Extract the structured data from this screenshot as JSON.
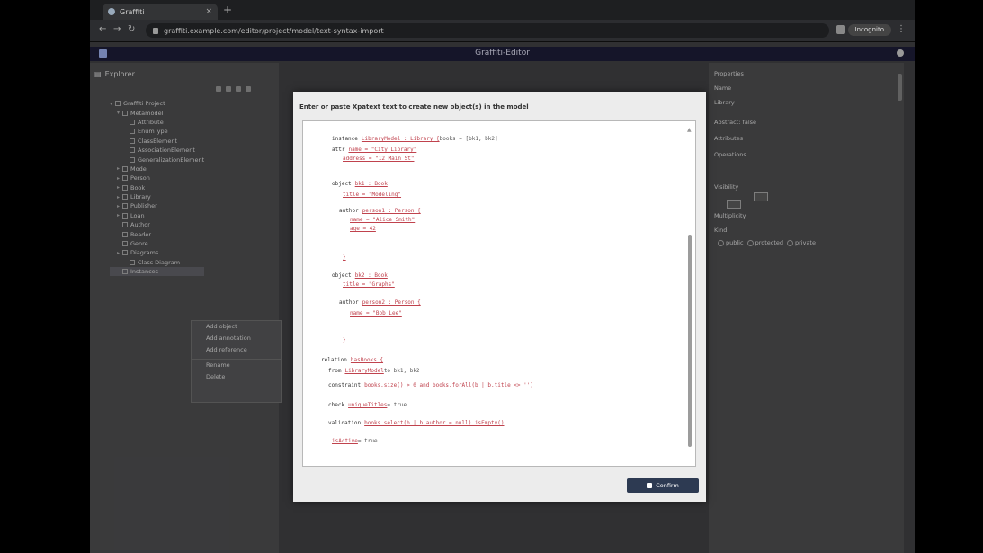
{
  "browser": {
    "tab_title": "Graffiti",
    "tab_close": "×",
    "new_tab": "+",
    "url": "graffiti.example.com/editor/project/model/text-syntax-import",
    "profile": "Incognito"
  },
  "app": {
    "title": "Graffiti-Editor"
  },
  "left_panel": {
    "title": "Explorer",
    "tree": [
      {
        "label": "Graffiti Project",
        "indent": 0,
        "twisty": "▾"
      },
      {
        "label": "Metamodel",
        "indent": 1,
        "twisty": "▾"
      },
      {
        "label": "Attribute",
        "indent": 2,
        "twisty": ""
      },
      {
        "label": "EnumType",
        "indent": 2,
        "twisty": ""
      },
      {
        "label": "ClassElement",
        "indent": 2,
        "twisty": ""
      },
      {
        "label": "AssociationElement",
        "indent": 2,
        "twisty": ""
      },
      {
        "label": "GeneralizationElement",
        "indent": 2,
        "twisty": ""
      },
      {
        "label": "Model",
        "indent": 1,
        "twisty": "▸"
      },
      {
        "label": "Person",
        "indent": 1,
        "twisty": "▸"
      },
      {
        "label": "Book",
        "indent": 1,
        "twisty": "▸"
      },
      {
        "label": "Library",
        "indent": 1,
        "twisty": "▸"
      },
      {
        "label": "Publisher",
        "indent": 1,
        "twisty": "▸"
      },
      {
        "label": "Loan",
        "indent": 1,
        "twisty": "▸"
      },
      {
        "label": "Author",
        "indent": 1,
        "twisty": ""
      },
      {
        "label": "Reader",
        "indent": 1,
        "twisty": ""
      },
      {
        "label": "Genre",
        "indent": 1,
        "twisty": ""
      },
      {
        "label": "Diagrams",
        "indent": 1,
        "twisty": "▸"
      },
      {
        "label": "Class Diagram",
        "indent": 2,
        "twisty": ""
      },
      {
        "label": "Instances",
        "indent": 1,
        "twisty": ""
      }
    ],
    "context_menu": [
      "Add object",
      "Add annotation",
      "Add reference",
      "Rename",
      "Delete"
    ]
  },
  "right_panel": {
    "title": "Properties",
    "lines": [
      "Name",
      "Library",
      "Abstract: false",
      "Attributes",
      "Operations",
      "Visibility",
      "Multiplicity",
      "Kind"
    ],
    "radio_labels": [
      "public",
      "protected",
      "private"
    ]
  },
  "modal": {
    "title": "Enter or paste Xpatext text to create new object(s) in the model",
    "code": [
      {
        "kw": "instance",
        "str": "LibraryModel : Library {",
        "pl": "books = [bk1, bk2]"
      },
      {
        "kw": "  attr",
        "str": "name = \"City Library\"",
        "pl": ""
      },
      {
        "kw": "    ",
        "str": "address = \"12 Main St\"",
        "pl": ""
      },
      {
        "kw": "object",
        "str": "bk1 : Book",
        "pl": ""
      },
      {
        "kw": "  ",
        "str": "title = \"Modeling\"",
        "pl": ""
      },
      {
        "kw": "  author",
        "str": "person1 : Person {",
        "pl": ""
      },
      {
        "kw": "    ",
        "str": "name = \"Alice Smith\"",
        "pl": ""
      },
      {
        "kw": "    ",
        "str": "age = 42",
        "pl": ""
      },
      {
        "kw": "  ",
        "str": "}",
        "pl": ""
      },
      {
        "kw": "object",
        "str": "bk2 : Book",
        "pl": ""
      },
      {
        "kw": "  ",
        "str": "title = \"Graphs\"",
        "pl": ""
      },
      {
        "kw": "  author",
        "str": "person2 : Person {",
        "pl": ""
      },
      {
        "kw": "    ",
        "str": "name = \"Bob Lee\"",
        "pl": ""
      },
      {
        "kw": "  ",
        "str": "}",
        "pl": ""
      },
      {
        "kw": "relation",
        "str": "hasBooks {",
        "pl": ""
      },
      {
        "kw": "  from",
        "str": "LibraryModel",
        "pl": "to bk1, bk2"
      },
      {
        "kw": "  constraint",
        "str": "books.size() > 0 and books.forAll(b | b.title <> '')",
        "pl": ""
      },
      {
        "kw": "  check",
        "str": "uniqueTitles",
        "pl": "= true"
      },
      {
        "kw": "  validation",
        "str": "books.select(b | b.author = null).isEmpty()",
        "pl": ""
      },
      {
        "kw": "  ",
        "str": "isActive",
        "pl": "= true"
      }
    ],
    "confirm_label": "Confirm"
  }
}
